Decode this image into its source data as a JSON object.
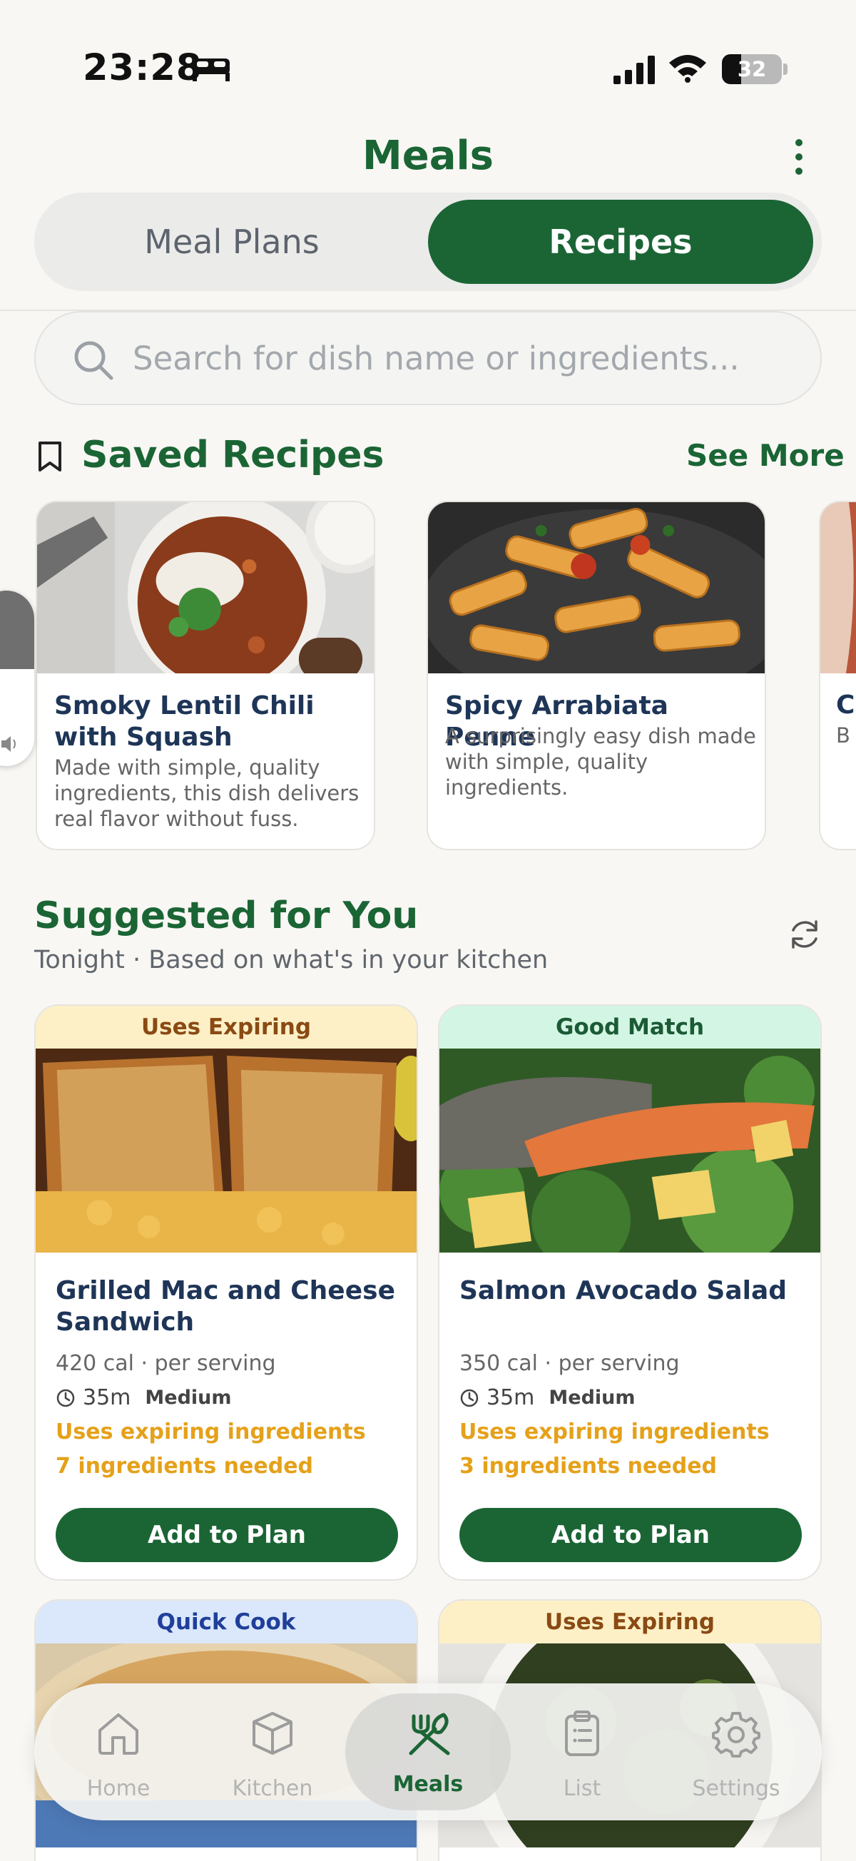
{
  "status_bar": {
    "time": "23:28",
    "battery": "32",
    "battery_level": 0.32
  },
  "header": {
    "title": "Meals"
  },
  "tabs": [
    {
      "label": "Meal Plans",
      "active": false
    },
    {
      "label": "Recipes",
      "active": true
    }
  ],
  "search": {
    "placeholder": "Search for dish name or ingredients..."
  },
  "saved": {
    "title": "Saved Recipes",
    "see_more": "See More",
    "cards": [
      {
        "name": "Smoky Lentil Chili with Squash",
        "description": "Made with simple, quality ingredients, this dish delivers real flavor without fuss."
      },
      {
        "name": "Spicy Arrabiata Penne",
        "description": "A surprisingly easy dish made with simple, quality ingredients."
      },
      {
        "name": "C",
        "description": "B"
      }
    ]
  },
  "suggested": {
    "title": "Suggested for You",
    "subtitle": "Tonight · Based on what's in your kitchen",
    "cards": [
      {
        "badge": "Uses Expiring",
        "name": "Grilled Mac and Cheese Sandwich",
        "calories": "420 cal · per serving",
        "time": "35m",
        "level": "Medium",
        "expiring": "Uses expiring ingredients",
        "needed": "7 ingredients needed",
        "action": "Add to Plan"
      },
      {
        "badge": "Good Match",
        "name": "Salmon Avocado Salad",
        "calories": "350 cal · per serving",
        "time": "35m",
        "level": "Medium",
        "expiring": "Uses expiring ingredients",
        "needed": "3 ingredients needed",
        "action": "Add to Plan"
      },
      {
        "badge": "Quick Cook"
      },
      {
        "badge": "Uses Expiring"
      }
    ]
  },
  "nav": [
    {
      "label": "Home",
      "icon": "home-icon"
    },
    {
      "label": "Kitchen",
      "icon": "box-icon"
    },
    {
      "label": "Meals",
      "icon": "utensils-icon",
      "active": true
    },
    {
      "label": "List",
      "icon": "clipboard-icon"
    },
    {
      "label": "Settings",
      "icon": "gear-icon"
    }
  ],
  "colors": {
    "brand": "#1b6535",
    "expiring": "#e5a11a",
    "navy": "#1e3557"
  }
}
